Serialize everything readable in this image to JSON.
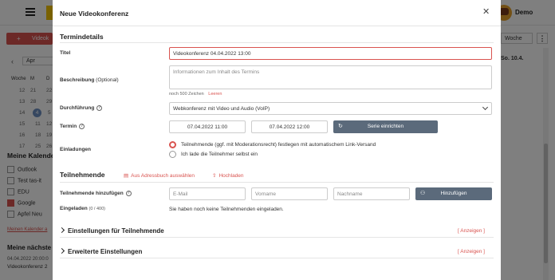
{
  "app": {
    "user_name": "Demo",
    "new_button_label": "Videok",
    "month_value": "Apr",
    "mini_calendar": {
      "headers": [
        "Woche",
        "M",
        "D"
      ],
      "rows": [
        [
          "12",
          "21",
          "22"
        ],
        [
          "13",
          "28",
          "29"
        ],
        [
          "14",
          "4",
          "5"
        ],
        [
          "15",
          "11",
          "12"
        ],
        [
          "16",
          "18",
          "19"
        ],
        [
          "17",
          "25",
          "26"
        ]
      ],
      "today": "4"
    },
    "calendars_title": "Meine Kalender",
    "calendars": [
      {
        "label": "Outlook",
        "checked": false
      },
      {
        "label": "Test tas-it",
        "checked": false
      },
      {
        "label": "EDU",
        "checked": false
      },
      {
        "label": "Google",
        "checked": true
      },
      {
        "label": "Apfel Neu",
        "checked": false
      }
    ],
    "calendars_link": "Meinen Kalender a",
    "next_title": "Meine nächste",
    "next_time": "04.04.2022 20:00:0",
    "next_name": "Videokonferenz 2",
    "view_select": "Woche",
    "day_header": "So. 10.4."
  },
  "modal": {
    "title": "Neue Videokonferenz",
    "section_details": "Termindetails",
    "title_label": "Titel",
    "title_value": "Videokonferenz 04.04.2022 13:00",
    "description_label": "Beschreibung",
    "description_optional": "(Optional)",
    "description_placeholder": "Informationen zum Inhalt des Termins",
    "chars_left": "noch 500 Zeichen",
    "clear_link": "Leeren",
    "execution_label": "Durchführung",
    "execution_value": "Webkonferenz mit Video und Audio (VoIP)",
    "date_label": "Termin",
    "start_value": "07.04.2022 11:00",
    "end_value": "07.04.2022 12:00",
    "series_button": "Serie einrichten",
    "invitations_label": "Einladungen",
    "invite_option_1": "Teilnehmende (ggf. mit Moderationsrecht) festlegen mit automatischem Link-Versand",
    "invite_option_2": "Ich lade die Teilnehmer selbst ein",
    "section_participants": "Teilnehmende",
    "address_book_link": "Aus Adressbuch auswählen",
    "upload_link": "Hochladen",
    "add_participants_label": "Teilnehmende hinzufügen",
    "email_placeholder": "E-Mail",
    "firstname_placeholder": "Vorname",
    "lastname_placeholder": "Nachname",
    "add_button": "Hinzufügen",
    "invited_label": "Eingeladen",
    "invited_count": "(0 / 400)",
    "no_participants_text": "Sie haben noch keine Teilnehmenden eingeladen.",
    "settings_participants": "Einstellungen für Teilnehmende",
    "advanced_settings": "Erweiterte Einstellungen",
    "show_link": "[ Anzeigen ]"
  },
  "colors": {
    "accent": "#d9534f",
    "button_dark": "#5b6a7b",
    "backdrop": "rgba(0,0,0,0.5)"
  }
}
